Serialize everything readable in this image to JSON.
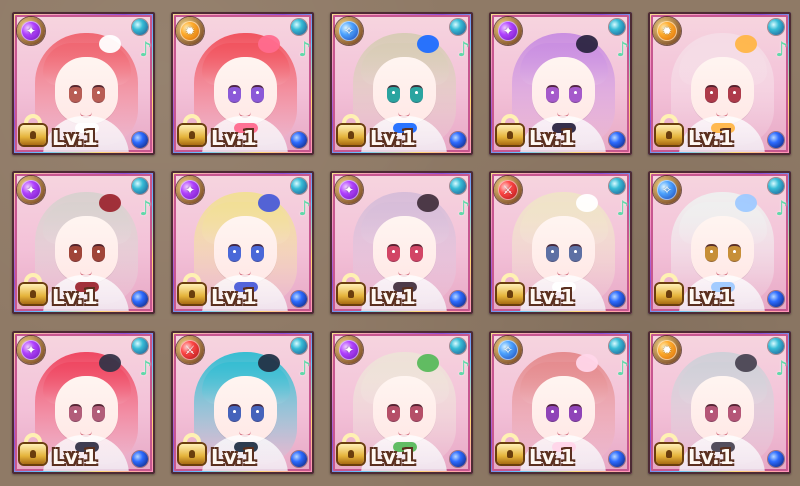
{
  "screen": {
    "title": ""
  },
  "cards": [
    {
      "level_label": "Lv.1",
      "type": "purple",
      "type_icon": "wand-icon",
      "hair": "#f06772",
      "accent": "#ffffff",
      "eye": "#b85d54"
    },
    {
      "level_label": "Lv.1",
      "type": "orange",
      "type_icon": "sun-icon",
      "hair": "#f1545f",
      "accent": "#ff6b8e",
      "eye": "#8b59d8"
    },
    {
      "level_label": "Lv.1",
      "type": "blue",
      "type_icon": "star-wand-icon",
      "hair": "#d8ccb6",
      "accent": "#1f6dff",
      "eye": "#2aa4a0"
    },
    {
      "level_label": "Lv.1",
      "type": "purple",
      "type_icon": "wand-icon",
      "hair": "#ca8fe1",
      "accent": "#2b2541",
      "eye": "#a55acb"
    },
    {
      "level_label": "Lv.1",
      "type": "orange",
      "type_icon": "sun-icon",
      "hair": "#f5dce6",
      "accent": "#ffb547",
      "eye": "#ae3b4a"
    },
    {
      "level_label": "Lv.1",
      "type": "purple",
      "type_icon": "wand-icon",
      "hair": "#d9d1cf",
      "accent": "#9d2730",
      "eye": "#a04538"
    },
    {
      "level_label": "Lv.1",
      "type": "purple",
      "type_icon": "wand-icon",
      "hair": "#f2df96",
      "accent": "#4a5cd8",
      "eye": "#4a68d8"
    },
    {
      "level_label": "Lv.1",
      "type": "purple",
      "type_icon": "wand-icon",
      "hair": "#d7bdd9",
      "accent": "#44313f",
      "eye": "#d24565"
    },
    {
      "level_label": "Lv.1",
      "type": "red",
      "type_icon": "sword-icon",
      "hair": "#f0e3c8",
      "accent": "#ffffff",
      "eye": "#5d70a4"
    },
    {
      "level_label": "Lv.1",
      "type": "blue",
      "type_icon": "star-wand-icon",
      "hair": "#efefef",
      "accent": "#9ec9ff",
      "eye": "#c78f37"
    },
    {
      "level_label": "Lv.1",
      "type": "purple",
      "type_icon": "wand-icon",
      "hair": "#ef4862",
      "accent": "#353448",
      "eye": "#b25d79"
    },
    {
      "level_label": "Lv.1",
      "type": "red",
      "type_icon": "sword-icon",
      "hair": "#37bdd2",
      "accent": "#233347",
      "eye": "#4563bb"
    },
    {
      "level_label": "Lv.1",
      "type": "purple",
      "type_icon": "wand-icon",
      "hair": "#eee2d8",
      "accent": "#58b95c",
      "eye": "#b54f68"
    },
    {
      "level_label": "Lv.1",
      "type": "blue",
      "type_icon": "star-wand-icon",
      "hair": "#e58c8f",
      "accent": "#ffd6e9",
      "eye": "#8f44b8"
    },
    {
      "level_label": "Lv.1",
      "type": "orange",
      "type_icon": "sun-icon",
      "hair": "#d0d0d8",
      "accent": "#4a4453",
      "eye": "#b55677"
    }
  ]
}
